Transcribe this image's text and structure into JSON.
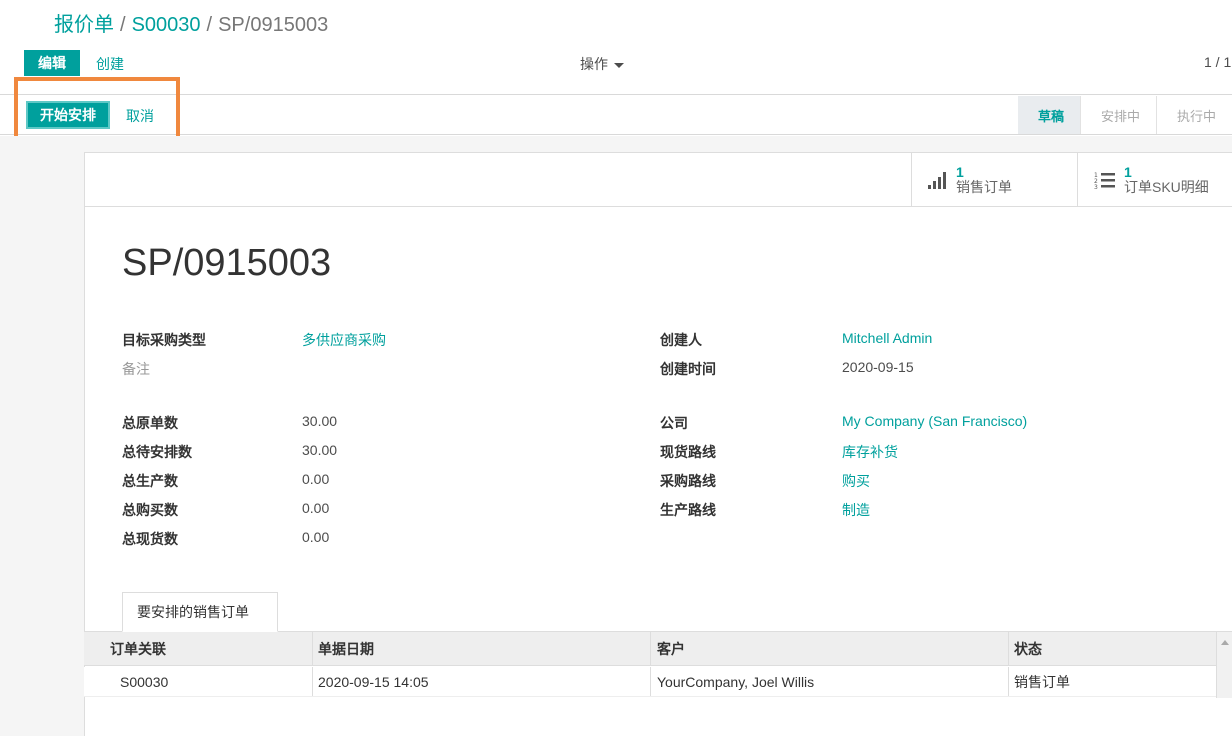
{
  "breadcrumb": {
    "parent": "报价单",
    "order": "S00030",
    "current": "SP/0915003",
    "separator": "/"
  },
  "toolbar": {
    "edit_label": "编辑",
    "create_label": "创建",
    "action_label": "操作",
    "pager": "1 / 1"
  },
  "statusbar": {
    "start_label": "开始安排",
    "cancel_label": "取消",
    "stages": [
      {
        "label": "草稿",
        "active": true
      },
      {
        "label": "安排中",
        "active": false
      },
      {
        "label": "执行中",
        "active": false
      }
    ]
  },
  "smart_buttons": {
    "sales": {
      "count": "1",
      "label": "销售订单",
      "icon": "bar-chart-icon"
    },
    "sku": {
      "count": "1",
      "label": "订单SKU明细",
      "icon": "ordered-list-icon"
    }
  },
  "record": {
    "title": "SP/0915003"
  },
  "fields_left": [
    {
      "label": "目标采购类型",
      "value": "多供应商采购",
      "link": true
    },
    {
      "label": "备注",
      "value": "",
      "muted": true
    },
    {
      "label": "总原单数",
      "value": "30.00"
    },
    {
      "label": "总待安排数",
      "value": "30.00"
    },
    {
      "label": "总生产数",
      "value": "0.00"
    },
    {
      "label": "总购买数",
      "value": "0.00"
    },
    {
      "label": "总现货数",
      "value": "0.00"
    }
  ],
  "fields_right": [
    {
      "label": "创建人",
      "value": "Mitchell Admin",
      "link": true
    },
    {
      "label": "创建时间",
      "value": "2020-09-15"
    },
    {
      "label": "公司",
      "value": "My Company (San Francisco)",
      "link": true
    },
    {
      "label": "现货路线",
      "value": "库存补货",
      "link": true
    },
    {
      "label": "采购路线",
      "value": "购买",
      "link": true
    },
    {
      "label": "生产路线",
      "value": "制造",
      "link": true
    }
  ],
  "tab": {
    "label": "要安排的销售订单"
  },
  "table": {
    "headers": [
      "订单关联",
      "单据日期",
      "客户",
      "状态"
    ],
    "rows": [
      [
        "S00030",
        "2020-09-15 14:05",
        "YourCompany, Joel Willis",
        "销售订单"
      ]
    ]
  },
  "colors": {
    "accent": "#00a09d",
    "highlight": "#f0883e"
  }
}
